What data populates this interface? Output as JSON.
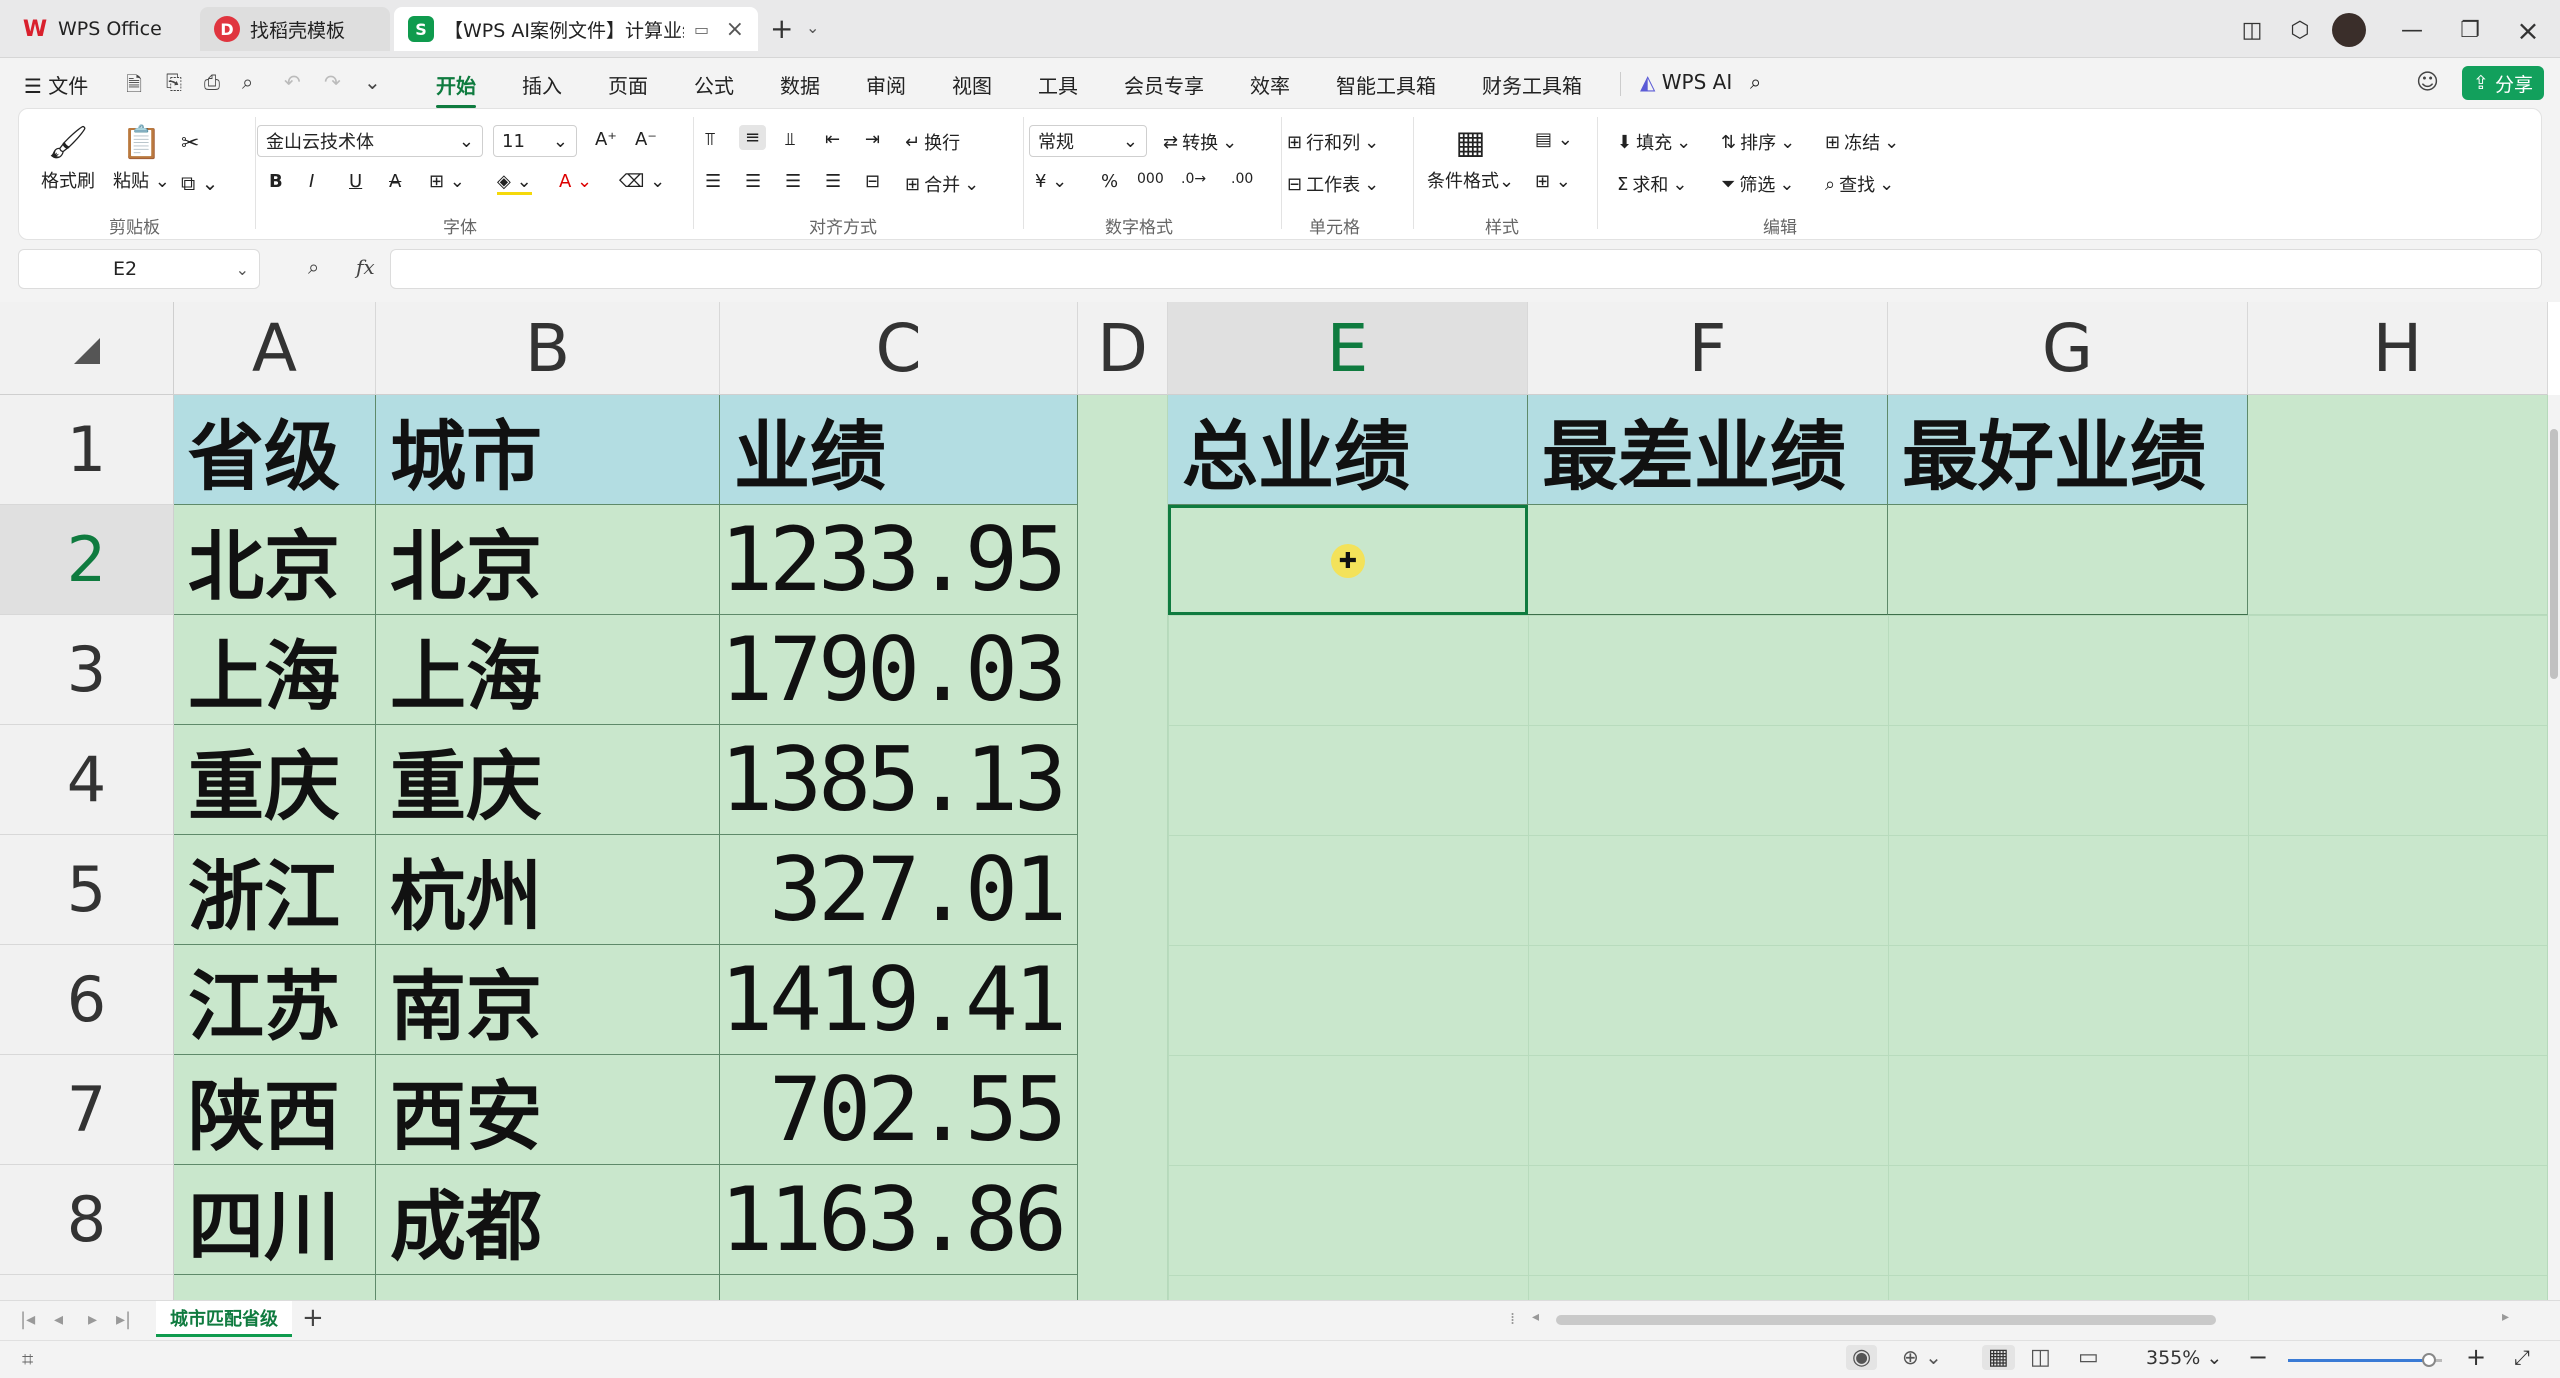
{
  "titlebar": {
    "tabs": [
      {
        "label": "WPS Office",
        "logo": "W",
        "color": "#d9202d"
      },
      {
        "label": "找稻壳模板",
        "logo": "D",
        "color": "#e0353f"
      },
      {
        "label": "【WPS AI案例文件】计算业绩",
        "logo": "S",
        "color": "#0f9b4e"
      }
    ],
    "new_tab": "+"
  },
  "menubar": {
    "file": "文件",
    "items": [
      "开始",
      "插入",
      "页面",
      "公式",
      "数据",
      "审阅",
      "视图",
      "工具",
      "会员专享",
      "效率",
      "智能工具箱",
      "财务工具箱"
    ],
    "active": "开始",
    "wps_ai": "WPS AI",
    "share": "分享"
  },
  "ribbon": {
    "clipboard": {
      "format_painter": "格式刷",
      "paste": "粘贴",
      "group": "剪贴板"
    },
    "font": {
      "family": "金山云技术体",
      "size": "11",
      "group": "字体"
    },
    "align": {
      "wrap": "换行",
      "merge": "合并",
      "group": "对齐方式"
    },
    "number": {
      "format": "常规",
      "convert": "转换",
      "group": "数字格式"
    },
    "cells": {
      "rowcol": "行和列",
      "sheet": "工作表",
      "group": "单元格"
    },
    "style": {
      "cond": "条件格式",
      "group": "样式"
    },
    "edit": {
      "fill": "填充",
      "sort": "排序",
      "freeze": "冻结",
      "sum": "求和",
      "filter": "筛选",
      "find": "查找",
      "group": "编辑"
    }
  },
  "formula_bar": {
    "name_box": "E2",
    "fx": "fx",
    "value": ""
  },
  "sheet": {
    "columns": [
      "A",
      "B",
      "C",
      "D",
      "E",
      "F",
      "G",
      "H"
    ],
    "selected_column": "E",
    "selected_row": "2",
    "rows": [
      "1",
      "2",
      "3",
      "4",
      "5",
      "6",
      "7",
      "8"
    ],
    "header": {
      "A": "省级",
      "B": "城市",
      "C": "业绩",
      "E": "总业绩",
      "F": "最差业绩",
      "G": "最好业绩"
    },
    "data": [
      {
        "province": "北京",
        "city": "北京",
        "value": "1233.95"
      },
      {
        "province": "上海",
        "city": "上海",
        "value": "1790.03"
      },
      {
        "province": "重庆",
        "city": "重庆",
        "value": "1385.13"
      },
      {
        "province": "浙江",
        "city": "杭州",
        "value": "327.01"
      },
      {
        "province": "江苏",
        "city": "南京",
        "value": "1419.41"
      },
      {
        "province": "陕西",
        "city": "西安",
        "value": "702.55"
      },
      {
        "province": "四川",
        "city": "成都",
        "value": "1163.86"
      }
    ],
    "partial_row": {
      "province": "…",
      "city": "…",
      "value": "…"
    }
  },
  "sheet_tabs": {
    "active": "城市匹配省级",
    "add": "+"
  },
  "statusbar": {
    "zoom": "355%"
  }
}
